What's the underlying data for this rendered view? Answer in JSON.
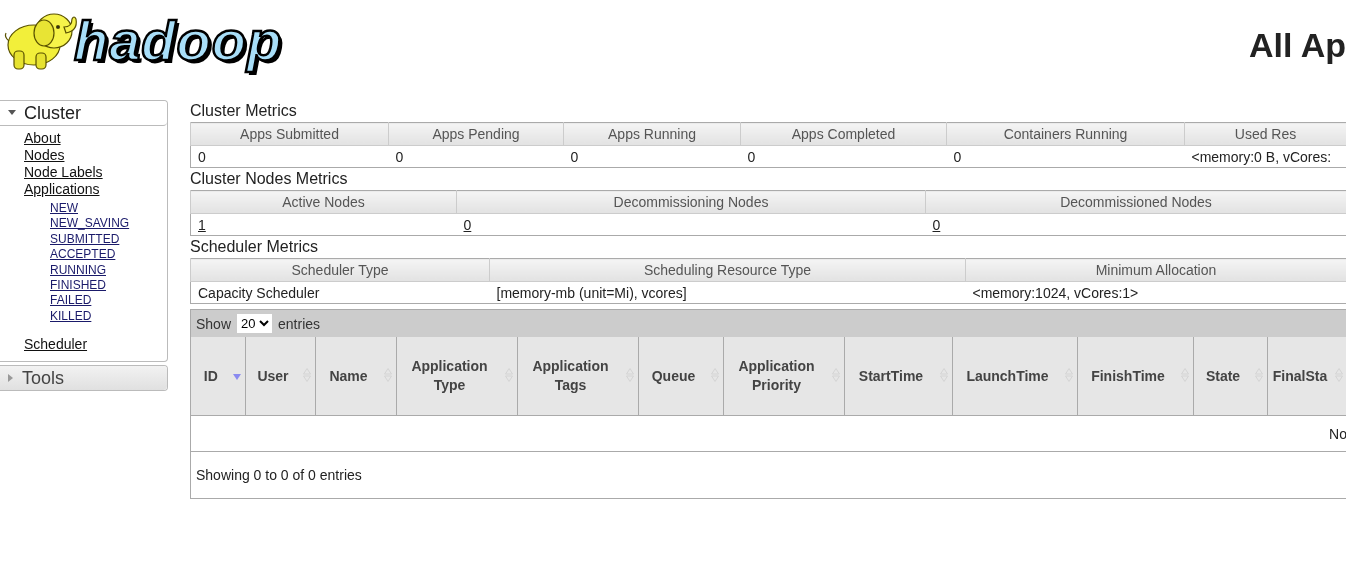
{
  "header": {
    "logo_text": "hadoop",
    "title": "All Ap"
  },
  "sidebar": [
    {
      "label": "Cluster",
      "expanded": true,
      "items": [
        {
          "label": "About"
        },
        {
          "label": "Nodes"
        },
        {
          "label": "Node Labels"
        },
        {
          "label": "Applications",
          "children": [
            {
              "label": "NEW"
            },
            {
              "label": "NEW_SAVING"
            },
            {
              "label": "SUBMITTED"
            },
            {
              "label": "ACCEPTED"
            },
            {
              "label": "RUNNING"
            },
            {
              "label": "FINISHED"
            },
            {
              "label": "FAILED"
            },
            {
              "label": "KILLED"
            }
          ]
        },
        {
          "label": "Scheduler"
        }
      ]
    },
    {
      "label": "Tools",
      "expanded": false
    }
  ],
  "metrics": [
    {
      "title": "Cluster Metrics",
      "columns": [
        "Apps Submitted",
        "Apps Pending",
        "Apps Running",
        "Apps Completed",
        "Containers Running",
        "Used Res"
      ],
      "cells": [
        {
          "text": "0",
          "link": false
        },
        {
          "text": "0",
          "link": false
        },
        {
          "text": "0",
          "link": false
        },
        {
          "text": "0",
          "link": false
        },
        {
          "text": "0",
          "link": false
        },
        {
          "text": "<memory:0 B, vCores:",
          "link": false
        }
      ]
    },
    {
      "title": "Cluster Nodes Metrics",
      "columns": [
        "Active Nodes",
        "Decommissioning Nodes",
        "Decommissioned Nodes"
      ],
      "cells": [
        {
          "text": "1",
          "link": true
        },
        {
          "text": "0",
          "link": true
        },
        {
          "text": "0",
          "link": true
        }
      ]
    },
    {
      "title": "Scheduler Metrics",
      "columns": [
        "Scheduler Type",
        "Scheduling Resource Type",
        "Minimum Allocation"
      ],
      "cells": [
        {
          "text": "Capacity Scheduler",
          "link": false
        },
        {
          "text": "[memory-mb (unit=Mi), vcores]",
          "link": false
        },
        {
          "text": "<memory:1024, vCores:1>",
          "link": false
        }
      ]
    }
  ],
  "apps": {
    "length_label_before": "Show",
    "page_size": "20",
    "length_label_after": "entries",
    "columns": [
      {
        "label": "ID",
        "sorted": true
      },
      {
        "label": "User",
        "sorted": false
      },
      {
        "label": "Name",
        "sorted": false
      },
      {
        "label": "Application Type",
        "sorted": false
      },
      {
        "label": "Application Tags",
        "sorted": false
      },
      {
        "label": "Queue",
        "sorted": false
      },
      {
        "label": "Application Priority",
        "sorted": false
      },
      {
        "label": "StartTime",
        "sorted": false
      },
      {
        "label": "LaunchTime",
        "sorted": false
      },
      {
        "label": "FinishTime",
        "sorted": false
      },
      {
        "label": "State",
        "sorted": false
      },
      {
        "label": "FinalSta",
        "sorted": false
      }
    ],
    "empty_text": "No",
    "info": "Showing 0 to 0 of 0 entries"
  }
}
